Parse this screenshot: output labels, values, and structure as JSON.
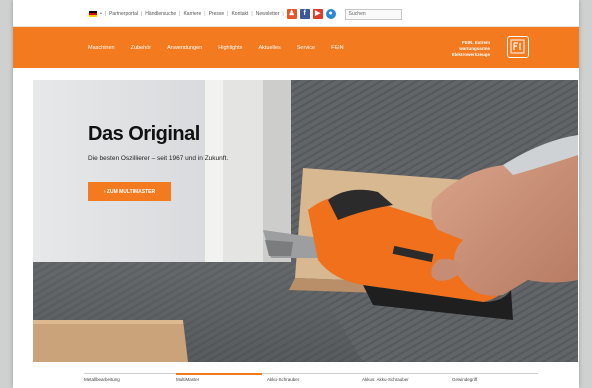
{
  "util": {
    "lang": "•",
    "links": [
      "Partnerportal",
      "Händlersuche",
      "Karriere",
      "Presse",
      "Kontakt",
      "Newsletter"
    ],
    "search_placeholder": "Suchen"
  },
  "nav": {
    "items": [
      "Maschinen",
      "Zubehör",
      "Anwendungen",
      "Highlights",
      "Aktuelles",
      "Service",
      "FEIN"
    ],
    "claim": "FEIN. Extrem wartungsarme Elektrowerkzeuge"
  },
  "hero": {
    "title": "Das Original",
    "subtitle": "Die besten Oszillierer – seit 1967 und in Zukunft.",
    "cta": "› ZUM MULTIMASTER"
  },
  "tabs": [
    "Metallbearbeitung",
    "MultiMaster",
    "Akku-Schrauber",
    "Akkus: Akku-Schrauber",
    "Gewindegriff"
  ],
  "colors": {
    "accent": "#f47a1f"
  }
}
